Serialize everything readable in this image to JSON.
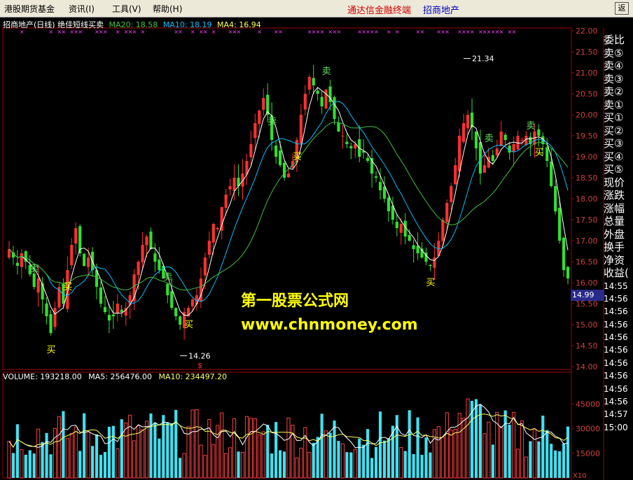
{
  "menu": {
    "items": [
      "港股期货基金",
      "资讯(I)",
      "工具(V)",
      "帮助(H)"
    ],
    "brand_left": "通达信金融终端",
    "brand_right": "招商地产",
    "window_button": "返"
  },
  "header": {
    "title": "招商地产(日线)",
    "formula": "绝佳短线买卖",
    "ma20": "MA20: 18.58",
    "ma10": "MA10: 18.19",
    "ma4": "MA4: 16.94"
  },
  "volume_header": {
    "label": "VOLUME: 193218.00",
    "ma5": "MA5: 256476.00",
    "ma10": "MA10: 234497.20"
  },
  "right_panel": {
    "labels": [
      "委比",
      "卖⑤",
      "卖④",
      "卖③",
      "卖②",
      "卖①",
      "买①",
      "买②",
      "买③",
      "买④",
      "买⑤",
      "现价",
      "涨跌",
      "涨幅",
      "总量",
      "外盘",
      "换手",
      "净资",
      "收益("
    ],
    "times": [
      "14:55",
      "14:56",
      "14:56",
      "14:56",
      "14:56",
      "14:56",
      "14:56",
      "14:56",
      "14:56",
      "14:56",
      "14:57",
      "15:00"
    ]
  },
  "watermark": {
    "line1": "第一股票公式网",
    "line2": "www.chnmoney.com"
  },
  "annotations": {
    "high_label": "21.34",
    "low_label": "14.26",
    "current_price": "14.99",
    "buy": "买",
    "sell": "卖",
    "dollar": "$",
    "x_mark": "×"
  },
  "colors": {
    "up": "#ff3030",
    "down": "#30e030",
    "ma4": "#ffffff",
    "ma10": "#00c0ff",
    "ma20": "#40c040",
    "signal": "#ffff00",
    "x_mark": "#ff40ff",
    "vol_up": "#ff4040",
    "vol_down": "#40e0f0"
  },
  "chart_data": {
    "type": "candlestick",
    "ylim": [
      14.0,
      22.0
    ],
    "yticks": [
      "22.00",
      "21.50",
      "21.00",
      "20.50",
      "20.00",
      "19.50",
      "19.00",
      "18.50",
      "18.00",
      "17.50",
      "17.00",
      "16.50",
      "16.00",
      "15.50",
      "15.00",
      "14.50",
      "14.00"
    ],
    "volume_ticks": [
      "45000",
      "30000",
      "15000"
    ],
    "volume_ylim": [
      0,
      60000
    ],
    "bottom_label": "X10",
    "closes": [
      16.8,
      16.6,
      16.4,
      16.7,
      16.5,
      16.2,
      15.9,
      16.1,
      15.6,
      15.2,
      14.8,
      15.4,
      15.9,
      15.5,
      16.3,
      16.9,
      17.3,
      16.7,
      16.4,
      16.6,
      16.3,
      15.9,
      15.5,
      15.3,
      15.1,
      15.2,
      15.5,
      15.3,
      15.4,
      15.7,
      16.2,
      16.5,
      16.9,
      17.1,
      16.8,
      16.5,
      16.3,
      16.1,
      15.7,
      15.4,
      15.2,
      15.0,
      15.3,
      15.4,
      15.6,
      15.7,
      16.1,
      16.6,
      17.0,
      17.4,
      17.3,
      17.8,
      18.1,
      18.3,
      18.5,
      18.3,
      18.6,
      18.9,
      19.3,
      19.8,
      20.1,
      20.4,
      20.0,
      19.4,
      19.0,
      18.8,
      18.5,
      18.6,
      18.9,
      19.4,
      20.0,
      20.5,
      20.9,
      20.7,
      20.5,
      20.2,
      20.6,
      20.3,
      19.9,
      19.6,
      19.5,
      19.3,
      19.2,
      19.3,
      19.0,
      19.1,
      18.9,
      18.6,
      18.5,
      18.2,
      18.0,
      17.7,
      17.5,
      17.3,
      17.4,
      17.1,
      17.0,
      16.8,
      16.7,
      16.6,
      16.5,
      16.4,
      16.6,
      17.0,
      17.5,
      17.9,
      18.3,
      18.8,
      19.5,
      19.8,
      20.0,
      19.7,
      19.2,
      18.6,
      18.8,
      19.0,
      18.9,
      19.2,
      19.6,
      19.4,
      19.1,
      19.3,
      19.5,
      19.4,
      19.5,
      19.3,
      19.6,
      19.5,
      19.3,
      18.9,
      18.3,
      17.7,
      17.0,
      16.3,
      16.1
    ],
    "highs_note": "21.34",
    "lows_note": "14.26",
    "volume_ma": {
      "ma5": 256476.0,
      "ma10": 234497.2,
      "last": 193218.0
    }
  }
}
